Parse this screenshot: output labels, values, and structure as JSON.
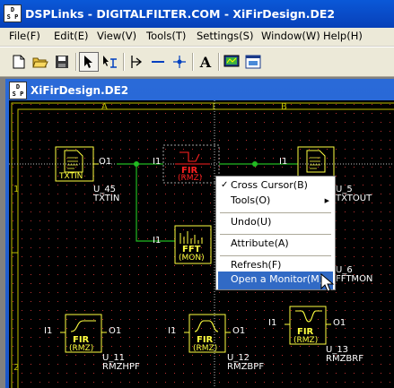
{
  "app": {
    "title": "DSPLinks - DIGITALFILTER.COM - XiFirDesign.DE2",
    "icon_text": [
      "D",
      "S P"
    ]
  },
  "menubar": [
    "File(F)",
    "Edit(E)",
    "View(V)",
    "Tools(T)",
    "Settings(S)",
    "Window(W)",
    "Help(H)"
  ],
  "toolbar": {
    "icons": [
      "new-file-icon",
      "open-folder-icon",
      "save-disk-icon",
      "pointer-arrow-icon",
      "connect-wire-icon",
      "probe-icon",
      "horizontal-line-icon",
      "cross-node-icon",
      "text-A-icon",
      "monitor-icon",
      "window-icon"
    ],
    "text_button": "A"
  },
  "child": {
    "title": "XiFirDesign.DE2"
  },
  "schematic": {
    "column_labels": [
      "A",
      "B"
    ],
    "row_labels": [
      "1",
      "2"
    ],
    "blocks": {
      "txtin": {
        "icon": "TXTIN",
        "name": "U_45",
        "type": "TXTIN",
        "port_out": "O1"
      },
      "fir_main": {
        "line1": "FIR",
        "line2": "(RMZ)",
        "port_in": "I1"
      },
      "txtout": {
        "icon": "TXTOUT",
        "name": "U_5",
        "type": "TXTOUT",
        "port_in": "I1"
      },
      "fft": {
        "line1": "FFT",
        "line2": "(MON)",
        "name": "U_6",
        "type": "FFTMON",
        "port_in": "I1"
      },
      "hpf": {
        "line1": "FIR",
        "line2": "(RMZ)",
        "name": "U_11",
        "type": "RMZHPF",
        "port_in": "I1",
        "port_out": "O1"
      },
      "bpf": {
        "line1": "FIR",
        "line2": "(RMZ)",
        "name": "U_12",
        "type": "RMZBPF",
        "port_in": "I1",
        "port_out": "O1"
      },
      "brf": {
        "line1": "FIR",
        "line2": "(RMZ)",
        "name": "U_13",
        "type": "RMZBRF",
        "port_in": "I1",
        "port_out": "O1"
      }
    }
  },
  "context_menu": {
    "items": [
      {
        "label": "Cross Cursor(B)",
        "checked": true
      },
      {
        "label": "Tools(O)",
        "submenu": true
      },
      {
        "label": "Undo(U)"
      },
      {
        "label": "Attribute(A)"
      },
      {
        "label": "Refresh(F)"
      },
      {
        "label": "Open a Monitor(M)",
        "selected": true
      }
    ],
    "check_mark": "✓",
    "submenu_arrow": "▶"
  },
  "colors": {
    "wire": "#22bb22",
    "block": "#ffff40",
    "selected_block": "#ff2020",
    "grid_dot": "#c03030",
    "grid_border": "#c0c000",
    "menu_highlight": "#316ac5"
  }
}
